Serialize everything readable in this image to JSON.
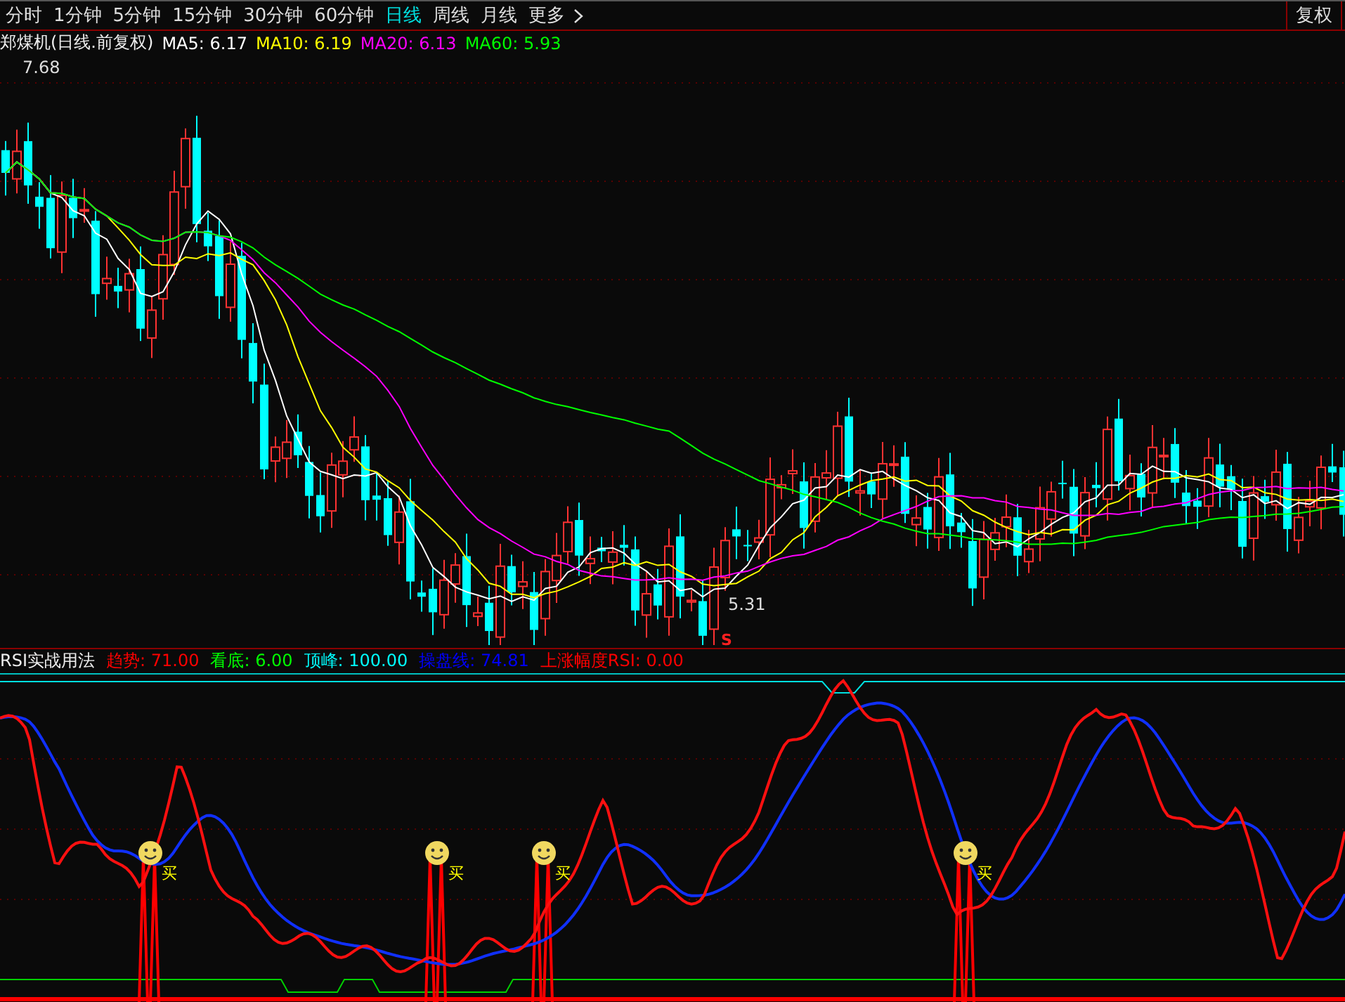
{
  "toolbar": {
    "periods": [
      {
        "label": "分时",
        "selected": false
      },
      {
        "label": "1分钟",
        "selected": false
      },
      {
        "label": "5分钟",
        "selected": false
      },
      {
        "label": "15分钟",
        "selected": false
      },
      {
        "label": "30分钟",
        "selected": false
      },
      {
        "label": "60分钟",
        "selected": false
      },
      {
        "label": "日线",
        "selected": true
      },
      {
        "label": "周线",
        "selected": false
      },
      {
        "label": "月线",
        "selected": false
      },
      {
        "label": "更多",
        "selected": false
      }
    ],
    "adjust_button": "复权"
  },
  "main_chart": {
    "title": "郑煤机(日线.前复权)",
    "indicators": [
      {
        "label": "MA5: 6.17",
        "color": "#ffffff"
      },
      {
        "label": "MA10: 6.19",
        "color": "#ffff00"
      },
      {
        "label": "MA20: 6.13",
        "color": "#ff00ff"
      },
      {
        "label": "MA60: 5.93",
        "color": "#00ff00"
      }
    ],
    "high_label": "7.68",
    "low_label": "5.31",
    "signal_mark": "S"
  },
  "indicator_panel": {
    "title": "RSI实战用法",
    "indicators": [
      {
        "label": "趋势: 71.00",
        "color": "#ff0000"
      },
      {
        "label": "看底: 6.00",
        "color": "#00ff00"
      },
      {
        "label": "顶峰: 100.00",
        "color": "#00ffff"
      },
      {
        "label": "操盘线: 74.81",
        "color": "#0000ff"
      },
      {
        "label": "上涨幅度RSI: 0.00",
        "color": "#ff0000"
      }
    ],
    "buy_signals": [
      {
        "label": "买"
      },
      {
        "label": "买"
      },
      {
        "label": "买"
      },
      {
        "label": "买"
      }
    ]
  }
}
